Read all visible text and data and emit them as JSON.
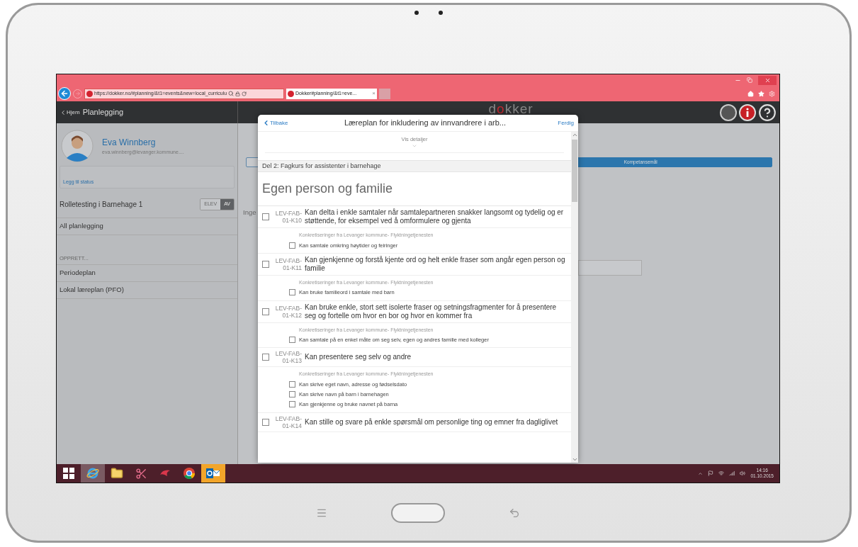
{
  "browser": {
    "address": "https://dokker.no/#planning/&t1=events&new=local_curriculu",
    "tab": {
      "title": "Dokker#planning/&t1=eve...",
      "close": "×"
    }
  },
  "header": {
    "back": "Hjem",
    "title": "Planlegging",
    "logo": "dokker"
  },
  "sidebar": {
    "profile": {
      "name": "Eva Winnberg",
      "email": "eva.winnberg@levanger.kommune...."
    },
    "status_link": "Legg til status",
    "role": {
      "label": "Rolletesting i Barnehage 1",
      "toggle": [
        {
          "label": "ELEV",
          "selected": false
        },
        {
          "label": "AV",
          "selected": true
        }
      ]
    },
    "items": [
      {
        "kind": "item",
        "label": "All planlegging"
      },
      {
        "kind": "heading",
        "label": "OPPRETT..."
      },
      {
        "kind": "item",
        "label": "Periodeplan"
      },
      {
        "kind": "item",
        "label": "Lokal læreplan (PFO)"
      }
    ]
  },
  "main": {
    "segments": [
      {
        "selected": false
      },
      {
        "label": "Kompetansemål",
        "selected": true
      }
    ],
    "partial_text": "Inge"
  },
  "modal": {
    "back": "Tilbake",
    "title": "Læreplan for inkludering av innvandrere i arb...",
    "done": "Ferdig",
    "details": "Vis detaljer",
    "section": "Del 2: Fagkurs for assistenter i barnehage",
    "heading": "Egen person og familie",
    "goals": [
      {
        "code": "LEV-FAB-01-K10",
        "text": "Kan delta i enkle samtaler når samtalepartneren snakker langsomt og tydelig og er støttende, for eksempel ved å omformulere og gjenta",
        "checked": false,
        "group": "Konkretiseringer fra Levanger kommune- Flyktningetjenesten",
        "items": [
          {
            "text": "Kan samtale omkring høytider og feiringer",
            "checked": false
          }
        ]
      },
      {
        "code": "LEV-FAB-01-K11",
        "text": "Kan gjenkjenne og forstå kjente ord og helt enkle fraser som angår egen person og familie",
        "checked": false,
        "group": "Konkretiseringer fra Levanger kommune- Flyktningetjenesten",
        "items": [
          {
            "text": "Kan bruke familieord i samtale med barn",
            "checked": false
          }
        ]
      },
      {
        "code": "LEV-FAB-01-K12",
        "text": "Kan bruke enkle, stort sett isolerte fraser og setningsfragmenter for å presentere seg og fortelle om hvor en bor og hvor en kommer fra",
        "checked": false,
        "group": "Konkretiseringer fra Levanger kommune- Flyktningetjenesten",
        "items": [
          {
            "text": "Kan samtale på en enkel måte om seg selv, egen og andres familie med kolleger",
            "checked": false
          }
        ]
      },
      {
        "code": "LEV-FAB-01-K13",
        "text": "Kan presentere seg selv og andre",
        "checked": false,
        "group": "Konkretiseringer fra Levanger kommune- Flyktningetjenesten",
        "items": [
          {
            "text": "Kan skrive eget navn, adresse og fødselsdato",
            "checked": false
          },
          {
            "text": "Kan skrive navn på barn i barnehagen",
            "checked": false
          },
          {
            "text": "Kan gjenkjenne og bruke navnet på barna",
            "checked": false
          }
        ]
      },
      {
        "code": "LEV-FAB-01-K14",
        "text": "Kan stille og svare på enkle spørsmål om personlige ting og emner fra dagliglivet",
        "checked": false
      }
    ]
  },
  "taskbar": {
    "apps": [
      {
        "kind": "start",
        "selected": false
      },
      {
        "kind": "browser",
        "selected": true
      },
      {
        "kind": "folder",
        "selected": false
      },
      {
        "kind": "scissors",
        "selected": false
      },
      {
        "kind": "swirl",
        "selected": false
      },
      {
        "kind": "chrome",
        "selected": false
      },
      {
        "kind": "mail",
        "selected": true
      }
    ],
    "time": "14:16",
    "date": "01.10.2015"
  }
}
